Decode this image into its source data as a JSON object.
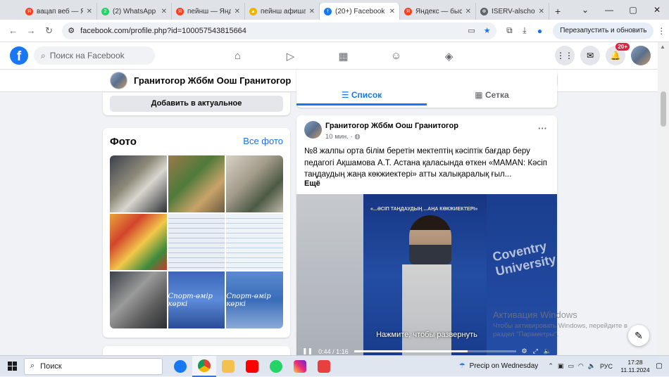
{
  "browser": {
    "tabs": [
      {
        "title": "вацап веб — Яндекс",
        "color": "#fc3f1d",
        "glyph": "Я"
      },
      {
        "title": "(2) WhatsApp",
        "color": "#25d366",
        "glyph": "2"
      },
      {
        "title": "пейнш — Яндекс",
        "color": "#fc3f1d",
        "glyph": "Я"
      },
      {
        "title": "пейнш афишасы",
        "color": "#f0b400",
        "glyph": "▲"
      },
      {
        "title": "(20+) Facebook",
        "color": "#1877f2",
        "glyph": "f"
      },
      {
        "title": "Яндекс — быстрый",
        "color": "#fc3f1d",
        "glyph": "Я"
      },
      {
        "title": "ISERV-alschool",
        "color": "#5f6368",
        "glyph": "⊕"
      }
    ],
    "active_tab": 4,
    "new_tab": "+",
    "url": "facebook.com/profile.php?id=100057543815664",
    "relaunch_label": "Перезапустить и обновить"
  },
  "facebook": {
    "search_placeholder": "Поиск на Facebook",
    "notifications_badge": "20+",
    "profile_name": "Гранитогор Жббм Оош Гранитогор",
    "add_featured": "Добавить в актуальное",
    "photos_title": "Фото",
    "all_photos": "Все фото",
    "sport_caption": "Спорт-өмір көркі",
    "tab_list": "Список",
    "tab_grid": "Сетка",
    "post": {
      "author": "Гранитогор Жббм Оош Гранитогор",
      "time": "10 мин. · ",
      "text": "№8 жалпы орта білім беретін мектептің кәсіптік бағдар беру педагогі Ақшамова А.Т.  Астана қаласында өткен «MAMAN: Кәсіп таңдаудың жаңа көкжиектері» атты халықаралық ғыл...",
      "more": "Ещё",
      "video_caption": "Нажмите, чтобы развернуть",
      "video_time": "0:44 / 1:16",
      "screen_heading": "«...ӘСІП ТАҢДАУДЫҢ ...АҢА КӨКЖИЕКТЕРІ»",
      "wall_text": "Coventry University"
    }
  },
  "watermark": {
    "title": "Активация Windows",
    "text": "Чтобы активировать Windows, перейдите в раздел \"Параметры\"."
  },
  "taskbar": {
    "search_label": "Поиск",
    "weather": "Precip on Wednesday",
    "lang": "РУС",
    "time": "17:28",
    "date": "11.11.2024"
  }
}
